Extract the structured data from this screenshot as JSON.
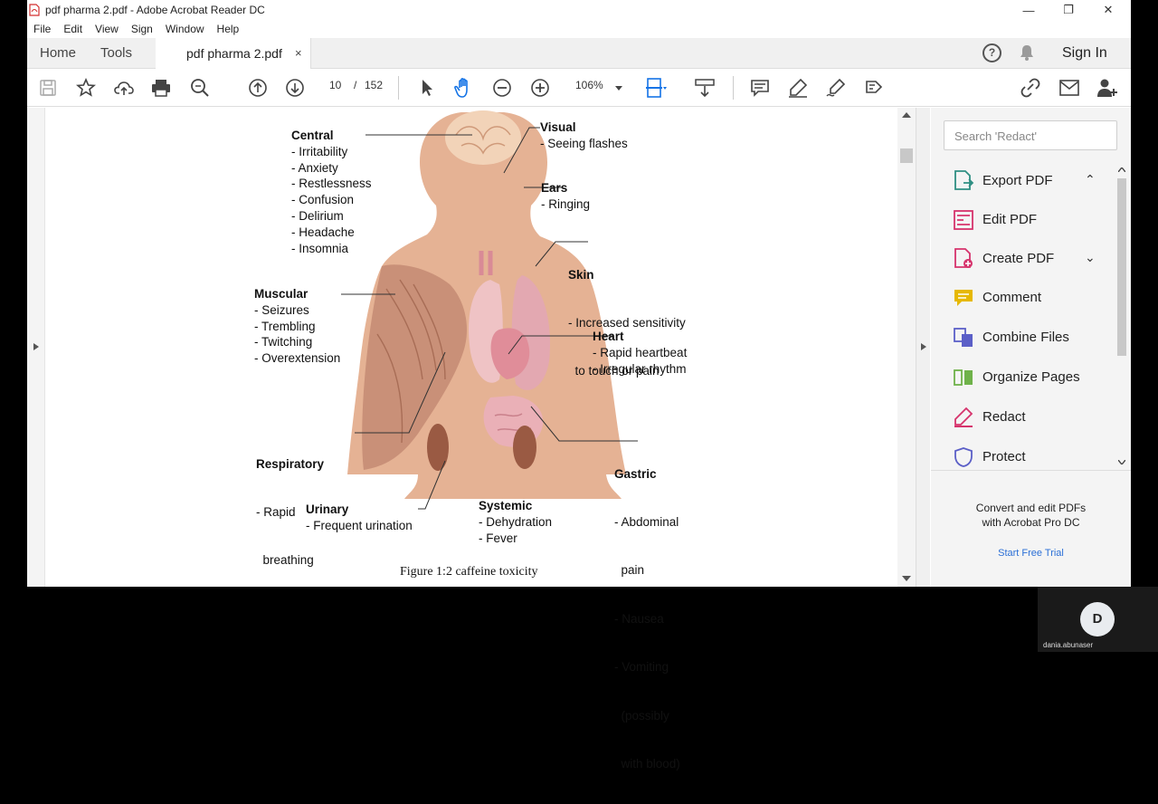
{
  "window": {
    "title": "pdf pharma 2.pdf - Adobe Acrobat Reader DC",
    "minimize": "—",
    "maximize": "❐",
    "close": "✕"
  },
  "menu": [
    "File",
    "Edit",
    "View",
    "Sign",
    "Window",
    "Help"
  ],
  "tabs": {
    "home": "Home",
    "tools": "Tools",
    "document": "pdf pharma 2.pdf",
    "close": "×"
  },
  "header": {
    "help": "?",
    "sign_in": "Sign In"
  },
  "toolbar": {
    "current_page": "10",
    "page_sep": "/",
    "total_pages": "152",
    "zoom": "106%"
  },
  "figure": {
    "central": {
      "title": "Central",
      "items": [
        "- Irritability",
        "- Anxiety",
        "- Restlessness",
        "- Confusion",
        "- Delirium",
        "- Headache",
        "- Insomnia"
      ]
    },
    "visual": {
      "title": "Visual",
      "items": [
        "- Seeing flashes"
      ]
    },
    "ears": {
      "title": "Ears",
      "items": [
        "- Ringing"
      ]
    },
    "skin": {
      "title": "Skin",
      "items": [
        "- Increased sensitivity",
        "  to touch or pain"
      ]
    },
    "muscular": {
      "title": "Muscular",
      "items": [
        "- Seizures",
        "- Trembling",
        "- Twitching",
        "- Overextension"
      ]
    },
    "heart": {
      "title": "Heart",
      "items": [
        "- Rapid heartbeat",
        "- Irregular rhythm"
      ]
    },
    "respiratory": {
      "title": "Respiratory",
      "items": [
        "- Rapid",
        "  breathing"
      ]
    },
    "gastric": {
      "title": "Gastric",
      "items": [
        "- Abdominal",
        "  pain",
        "- Nausea",
        "- Vomiting",
        "  (possibly",
        "  with blood)"
      ]
    },
    "urinary": {
      "title": "Urinary",
      "items": [
        "- Frequent urination"
      ]
    },
    "systemic": {
      "title": "Systemic",
      "items": [
        "- Dehydration",
        "- Fever"
      ]
    },
    "caption": "Figure 1:2 caffeine toxicity"
  },
  "right_panel": {
    "search_placeholder": "Search 'Redact'",
    "tools": [
      {
        "label": "Export PDF",
        "icon": "export-pdf-icon",
        "color": "#2f8f83",
        "chevron": "⌃"
      },
      {
        "label": "Edit PDF",
        "icon": "edit-pdf-icon",
        "color": "#d6336c"
      },
      {
        "label": "Create PDF",
        "icon": "create-pdf-icon",
        "color": "#d6336c",
        "chevron": "⌄"
      },
      {
        "label": "Comment",
        "icon": "comment-icon",
        "color": "#e6b800"
      },
      {
        "label": "Combine Files",
        "icon": "combine-files-icon",
        "color": "#5b5fc7"
      },
      {
        "label": "Organize Pages",
        "icon": "organize-pages-icon",
        "color": "#6fb24a"
      },
      {
        "label": "Redact",
        "icon": "redact-icon",
        "color": "#d6336c"
      },
      {
        "label": "Protect",
        "icon": "protect-icon",
        "color": "#5b5fc7"
      }
    ],
    "promo_line1": "Convert and edit PDFs",
    "promo_line2": "with Acrobat Pro DC",
    "trial": "Start Free Trial"
  },
  "participant": {
    "initial": "D",
    "name": "dania.abunaser"
  }
}
